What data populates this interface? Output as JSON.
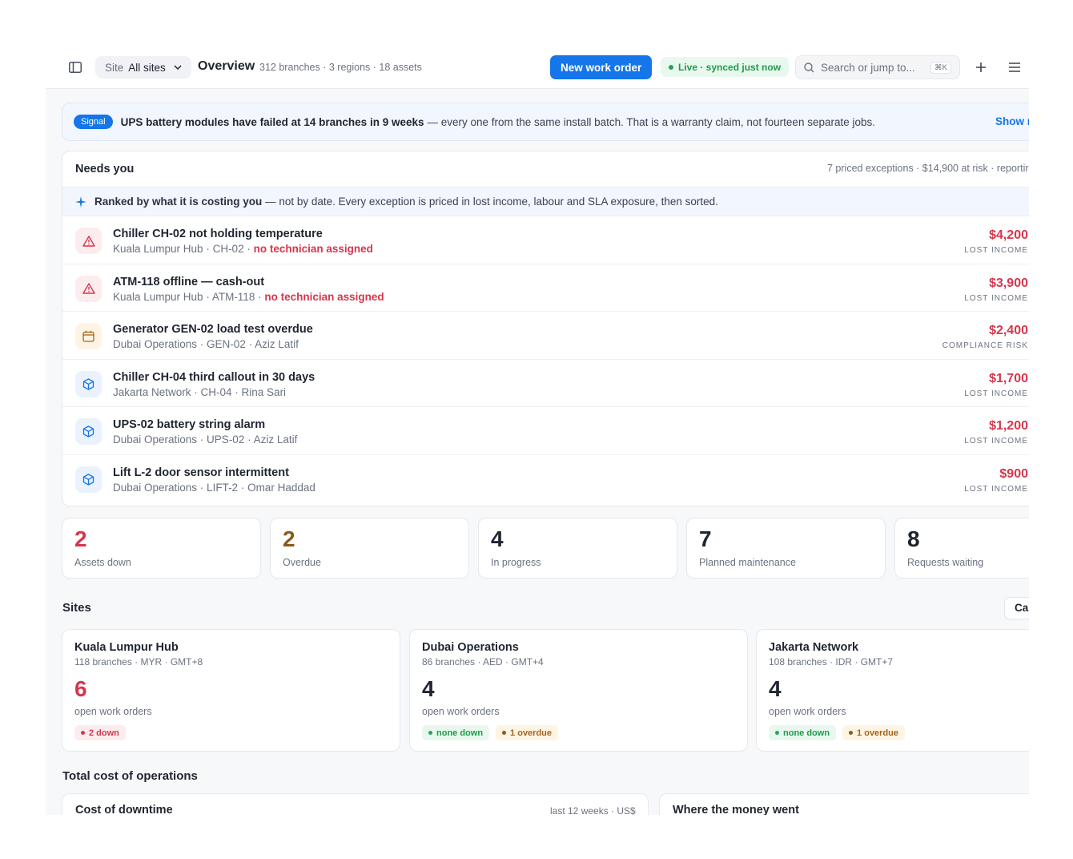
{
  "topbar": {
    "site_label": "Site",
    "site_value": "All sites",
    "title": "Overview",
    "meta": "312 branches · 3 regions · 18 assets",
    "new_work_order": "New work order",
    "live_status": "Live · synced just now",
    "search_placeholder": "Search or jump to...",
    "search_shortcut": "⌘K"
  },
  "signal": {
    "badge": "Signal",
    "headline": "UPS battery modules have failed at 14 branches in 9 weeks",
    "detail": "— every one from the same install batch. That is a warranty claim, not fourteen separate jobs.",
    "link": "Show r"
  },
  "needs_you": {
    "title": "Needs you",
    "meta": "7 priced exceptions · $14,900 at risk · reportir",
    "ranked_strong": "Ranked by what it is costing you",
    "ranked_rest": "— not by date. Every exception is priced in lost income, labour and SLA exposure, then sorted.",
    "items": [
      {
        "title": "Chiller CH-02 not holding temperature",
        "sub": "Kuala Lumpur Hub · CH-02 · ",
        "warn": "no technician assigned",
        "amount": "$4,200",
        "amount_label": "LOST INCOME",
        "icon": "alert-triangle-icon",
        "tone": "red"
      },
      {
        "title": "ATM-118 offline — cash-out",
        "sub": "Kuala Lumpur Hub · ATM-118 · ",
        "warn": "no technician assigned",
        "amount": "$3,900",
        "amount_label": "LOST INCOME",
        "icon": "alert-triangle-icon",
        "tone": "red"
      },
      {
        "title": "Generator GEN-02 load test overdue",
        "sub": "Dubai Operations · GEN-02 · Aziz Latif",
        "warn": "",
        "amount": "$2,400",
        "amount_label": "COMPLIANCE RISK",
        "icon": "calendar-icon",
        "tone": "amber"
      },
      {
        "title": "Chiller CH-04 third callout in 30 days",
        "sub": "Jakarta Network · CH-04 · Rina Sari",
        "warn": "",
        "amount": "$1,700",
        "amount_label": "LOST INCOME",
        "icon": "box-icon",
        "tone": "blue"
      },
      {
        "title": "UPS-02 battery string alarm",
        "sub": "Dubai Operations · UPS-02 · Aziz Latif",
        "warn": "",
        "amount": "$1,200",
        "amount_label": "LOST INCOME",
        "icon": "box-icon",
        "tone": "blue"
      },
      {
        "title": "Lift L-2 door sensor intermittent",
        "sub": "Dubai Operations · LIFT-2 · Omar Haddad",
        "warn": "",
        "amount": "$900",
        "amount_label": "LOST INCOME",
        "icon": "box-icon",
        "tone": "blue"
      }
    ]
  },
  "stats": [
    {
      "value": "2",
      "label": "Assets down",
      "color": "#d6364d"
    },
    {
      "value": "2",
      "label": "Overdue",
      "color": "#8a5a1a"
    },
    {
      "value": "4",
      "label": "In progress",
      "color": "#1f2430"
    },
    {
      "value": "7",
      "label": "Planned maintenance",
      "color": "#1f2430"
    },
    {
      "value": "8",
      "label": "Requests waiting",
      "color": "#1f2430"
    }
  ],
  "sites": {
    "title": "Sites",
    "button": "Ca",
    "items": [
      {
        "name": "Kuala Lumpur Hub",
        "meta": "118 branches · MYR · GMT+8",
        "count": "6",
        "count_label": "open work orders",
        "count_color": "#d6364d",
        "tag1": "2 down",
        "tag2": ""
      },
      {
        "name": "Dubai Operations",
        "meta": "86 branches · AED · GMT+4",
        "count": "4",
        "count_label": "open work orders",
        "count_color": "#1f2430",
        "tag1": "none down",
        "tag2": "1 overdue"
      },
      {
        "name": "Jakarta Network",
        "meta": "108 branches · IDR · GMT+7",
        "count": "4",
        "count_label": "open work orders",
        "count_color": "#1f2430",
        "tag1": "none down",
        "tag2": "1 overdue"
      }
    ]
  },
  "total_cost": {
    "title": "Total cost of operations",
    "downtime_title": "Cost of downtime",
    "downtime_meta": "last 12 weeks · US$",
    "money_title": "Where the money went"
  }
}
